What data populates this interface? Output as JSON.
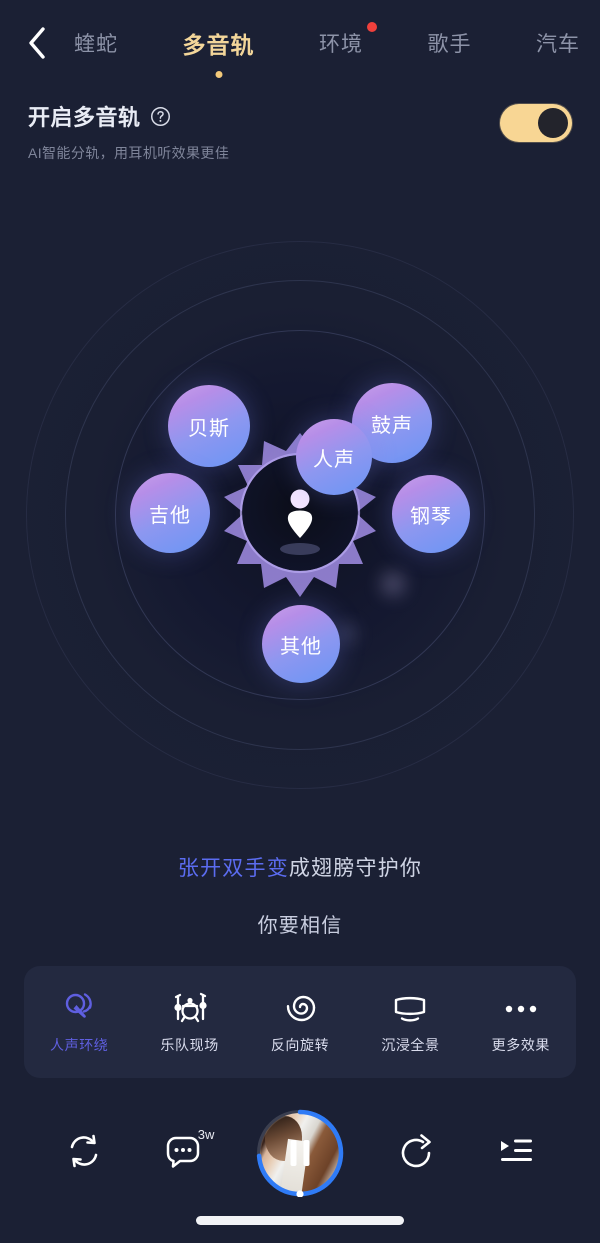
{
  "topbar": {
    "back_icon": "chevron-left-icon",
    "tabs": [
      {
        "label": "蝰蛇",
        "active": false,
        "badge": false
      },
      {
        "label": "多音轨",
        "active": true,
        "badge": false
      },
      {
        "label": "环境",
        "active": false,
        "badge": true
      },
      {
        "label": "歌手",
        "active": false,
        "badge": false
      },
      {
        "label": "汽车",
        "active": false,
        "badge": false
      }
    ]
  },
  "setting": {
    "title": "开启多音轨",
    "help_icon": "question-circle-icon",
    "subtitle": "AI智能分轨，用耳机听效果更佳",
    "toggle_on": true,
    "toggle_color": "#f8d694"
  },
  "visualizer": {
    "center_icon": "listener-person-icon",
    "bubbles": [
      {
        "id": "bass",
        "label": "贝斯"
      },
      {
        "id": "drums",
        "label": "鼓声"
      },
      {
        "id": "vocal",
        "label": "人声"
      },
      {
        "id": "guitar",
        "label": "吉他"
      },
      {
        "id": "piano",
        "label": "钢琴"
      },
      {
        "id": "other",
        "label": "其他"
      }
    ],
    "bubble_gradient_from": "#c9a0ea",
    "bubble_gradient_to": "#6a95f5"
  },
  "lyrics": {
    "line1_highlight": "张开双手变",
    "line1_rest": "成翅膀守护你",
    "line2": "你要相信",
    "highlight_color": "#5b6cf0"
  },
  "effects": {
    "accent_color": "#5f5fe0",
    "items": [
      {
        "label": "人声环绕",
        "icon": "vocal-surround-icon",
        "active": true
      },
      {
        "label": "乐队现场",
        "icon": "drumkit-icon",
        "active": false
      },
      {
        "label": "反向旋转",
        "icon": "spiral-icon",
        "active": false
      },
      {
        "label": "沉浸全景",
        "icon": "panorama-screen-icon",
        "active": false
      },
      {
        "label": "更多效果",
        "icon": "more-dots-icon",
        "active": false
      }
    ]
  },
  "player": {
    "loop_icon": "repeat-icon",
    "comment_icon": "comment-icon",
    "comment_count": "3w",
    "album_icon": "album-art",
    "playback_state": "playing",
    "pause_icon": "pause-icon",
    "progress_percent": 74,
    "progress_color": "#2f7bf6",
    "share_icon": "share-icon",
    "playlist_icon": "playlist-icon"
  }
}
